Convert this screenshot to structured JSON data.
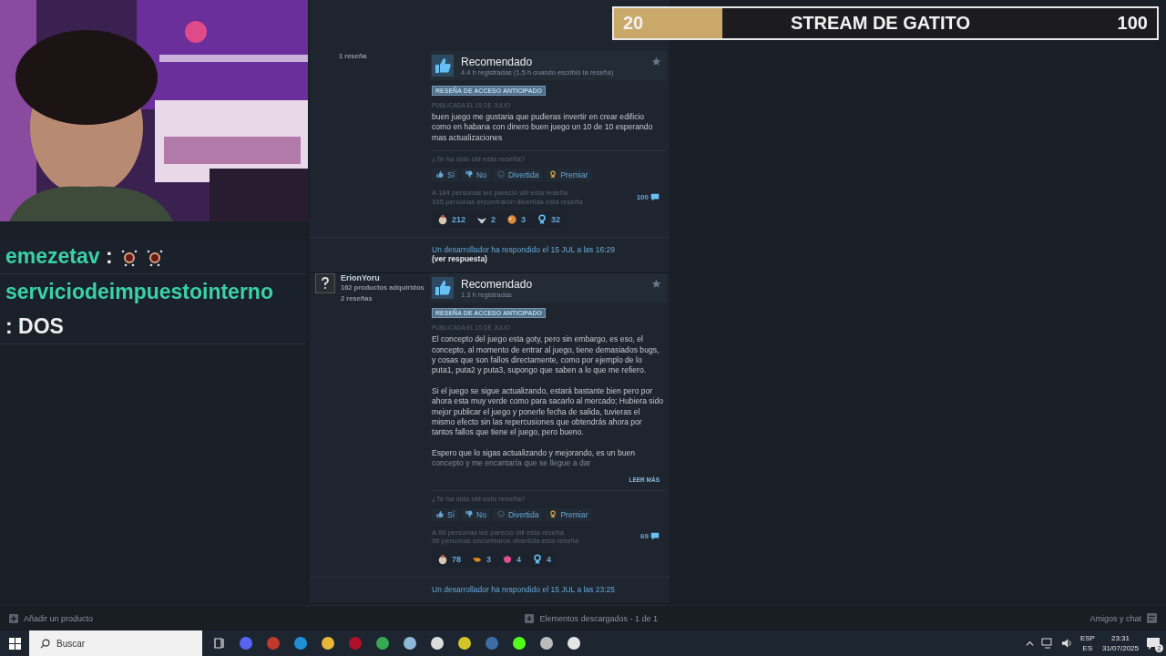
{
  "chat": {
    "messages": [
      {
        "user": "emezetav",
        "separator": ":",
        "emotes": [
          {
            "kind": "emote"
          },
          {
            "kind": "emote"
          }
        ]
      },
      {
        "user": "serviciodeimpuestointerno",
        "separator": ":",
        "text": "DOS"
      }
    ]
  },
  "goal": {
    "start": "20",
    "title": "STREAM DE GATITO",
    "target": "100",
    "level": 0.2
  },
  "reviews": [
    {
      "author_meta": [
        "1 reseña"
      ],
      "title": "Recomendado",
      "hours": "4.4 h registradas (1.5 h cuando escribió la reseña)",
      "badge": "RESEÑA DE ACCESO ANTICIPADO",
      "posted": "PUBLICADA EL 15 DE JULIO",
      "paragraphs": [
        "buen juego me gustaria que pudieras invertir en crear edificio como en habana con dinero buen juego un 10 de 10 esperando mas actualizaciones"
      ],
      "helpful_prompt": "¿Te ha sido útil esta reseña?",
      "buttons": [
        {
          "kind": "yes",
          "label": "Sí"
        },
        {
          "kind": "no",
          "label": "No"
        },
        {
          "kind": "funny",
          "label": "Divertida"
        },
        {
          "kind": "award",
          "label": "Premiar"
        }
      ],
      "helpful_text": "A 184 personas les pareció útil esta reseña",
      "funny_text": "155 personas encontraron divertida esta reseña",
      "comments": "100",
      "awards": [
        {
          "count": "212"
        },
        {
          "count": "2"
        },
        {
          "count": "3"
        },
        {
          "count": "32"
        }
      ],
      "dev_reply": "Un desarrollador ha respondido el 15 JUL a las 16:29",
      "reply_link": "(ver respuesta)"
    },
    {
      "author_name": "ErionYoru",
      "author_meta": [
        "162 productos adquiridos",
        "2 reseñas"
      ],
      "title": "Recomendado",
      "hours": "1.3 h registradas",
      "badge": "RESEÑA DE ACCESO ANTICIPADO",
      "posted": "PUBLICADA EL 15 DE JULIO",
      "paragraphs": [
        "El concepto del juego esta goty, pero sin embargo, es eso, el concepto, al momento de entrar al juego, tiene demasiados bugs, y cosas que son fallos directamente, como por ejemplo de lo puta1, puta2 y puta3, supongo que saben a lo que me refiero.",
        "Si el juego se sigue actualizando, estará bastante bien pero por ahora esta muy verde como para sacarlo al mercado; Hubiera sido mejor publicar el juego y ponerle fecha de salida, tuvieras el mismo efecto sin las repercusiones que obtendrás ahora por tantos fallos que tiene el juego, pero bueno.",
        "Espero que lo sigas actualizando y mejorando, es un buen"
      ],
      "faded_tail": "concepto y me encantaría que se llegue a dar",
      "read_more": "LEER MÁS",
      "helpful_prompt": "¿Te ha sido útil esta reseña?",
      "buttons": [
        {
          "kind": "yes",
          "label": "Sí"
        },
        {
          "kind": "no",
          "label": "No"
        },
        {
          "kind": "funny",
          "label": "Divertida"
        },
        {
          "kind": "award",
          "label": "Premiar"
        }
      ],
      "helpful_text": "A 99 personas les pareció útil esta reseña",
      "funny_text": "96 personas encontraron divertida esta reseña",
      "comments": "69",
      "awards": [
        {
          "count": "78"
        },
        {
          "count": "3"
        },
        {
          "count": "4"
        },
        {
          "count": "4"
        }
      ],
      "dev_reply": "Un desarrollador ha respondido el 15 JUL a las 23:25"
    }
  ],
  "footer": {
    "add": "Añadir un producto",
    "downloads": "Elementos descargados - 1 de 1",
    "friends": "Amigos y chat"
  },
  "taskbar": {
    "search_placeholder": "Buscar",
    "apps": [
      {
        "color": "#5865f2"
      },
      {
        "color": "#c0392b"
      },
      {
        "color": "#1f8fd6"
      },
      {
        "color": "#e8b73a"
      },
      {
        "color": "#b0102a"
      },
      {
        "color": "#34a853"
      },
      {
        "color": "#8fb7d8"
      },
      {
        "color": "#dddddd"
      },
      {
        "color": "#d4c42a"
      },
      {
        "color": "#3b6ea5"
      },
      {
        "color": "#53fc18"
      },
      {
        "color": "#bbbbbb"
      },
      {
        "color": "#e5e5e5"
      }
    ],
    "language": "ESP",
    "region": "ES",
    "time": "23:31",
    "date": "31/07/2025",
    "notifications": "2"
  }
}
